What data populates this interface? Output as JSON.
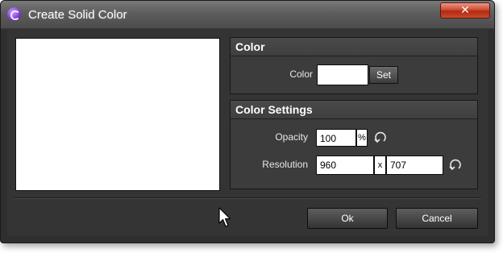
{
  "window": {
    "title": "Create Solid Color",
    "close_symbol": "✕",
    "app_icon": "app-logo-icon"
  },
  "color_panel": {
    "heading": "Color",
    "color_label": "Color",
    "color_value": "#ffffff",
    "set_button": "Set"
  },
  "settings_panel": {
    "heading": "Color Settings",
    "opacity_label": "Opacity",
    "opacity_value": "100",
    "opacity_unit": "%",
    "resolution_label": "Resolution",
    "width_value": "960",
    "separator": "x",
    "height_value": "707",
    "reset_icon": "reset-icon"
  },
  "buttons": {
    "ok": "Ok",
    "cancel": "Cancel"
  },
  "colors": {
    "dialog_bg": "#343434",
    "panel_bg": "#3c3c3c",
    "close_button": "#c9442b"
  }
}
